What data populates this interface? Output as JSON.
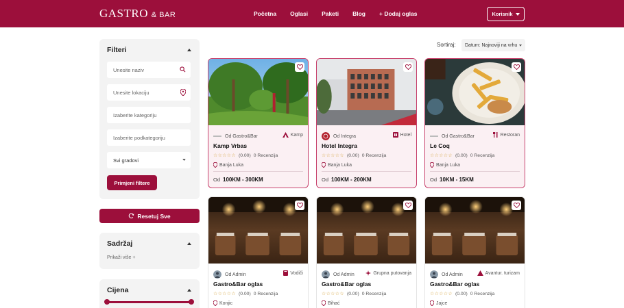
{
  "header": {
    "logo_main": "GASTRO",
    "logo_amp": "& BAR",
    "nav": [
      "Početna",
      "Oglasi",
      "Paketi",
      "Blog",
      "+ Dodaj oglas"
    ],
    "user_label": "Korisnik"
  },
  "filters": {
    "title": "Filteri",
    "name_placeholder": "Unesite naziv",
    "location_placeholder": "Unesite lokaciju",
    "category_placeholder": "Izaberite kategoriju",
    "subcategory_placeholder": "Izaberite podkategoriju",
    "city_select": "Svi gradovi",
    "apply_label": "Primjeni filtere"
  },
  "reset_label": "Resetuj Sve",
  "content_panel": {
    "title": "Sadržaj",
    "show_more": "Prikaži više +"
  },
  "price_panel": {
    "title": "Cijena"
  },
  "sort": {
    "label": "Sortiraj:",
    "value": "Datum: Najnoviji na vrhu"
  },
  "colors": {
    "brand": "#9c0f3b",
    "panel_bg": "#f3f3f3",
    "highlight_border": "#c7416c"
  },
  "cards": [
    {
      "owner": "Od Gastro&Bar",
      "category": "Kamp",
      "category_icon": "tent-icon",
      "title": "Kamp Vrbas",
      "stars": "☆☆☆☆☆",
      "rating": "(0.00)",
      "reviews": "0 Recenzija",
      "location": "Banja Luka",
      "price_prefix": "Od",
      "price": "100KM - 300KM",
      "image": "park-photo"
    },
    {
      "owner": "Od Integra",
      "category": "Hotel",
      "category_icon": "hotel-icon",
      "title": "Hotel Integra",
      "stars": "☆☆☆☆☆",
      "rating": "(0.00)",
      "reviews": "0 Recenzija",
      "location": "Banja Luka",
      "price_prefix": "Od",
      "price": "100KM - 200KM",
      "image": "building-photo"
    },
    {
      "owner": "Od Gastro&Bar",
      "category": "Restoran",
      "category_icon": "fork-knife-icon",
      "title": "Le Coq",
      "stars": "☆☆☆☆☆",
      "rating": "(0.00)",
      "reviews": "0 Recenzija",
      "location": "Banja Luka",
      "price_prefix": "Od",
      "price": "10KM - 15KM",
      "image": "food-photo"
    },
    {
      "owner": "Od Admin",
      "category": "Vodiči",
      "category_icon": "book-icon",
      "title": "Gastro&Bar oglas",
      "stars": "☆☆☆☆☆",
      "rating": "(0.00)",
      "reviews": "0 Recenzija",
      "location": "Konjic",
      "image": "restaurant-photo"
    },
    {
      "owner": "Od Admin",
      "category": "Grupna putovanja",
      "category_icon": "plane-icon",
      "title": "Gastro&Bar oglas",
      "stars": "☆☆☆☆☆",
      "rating": "(0.00)",
      "reviews": "0 Recenzija",
      "location": "Bihać",
      "image": "restaurant-photo"
    },
    {
      "owner": "Od Admin",
      "category": "Avantur. turizam",
      "category_icon": "mountain-icon",
      "title": "Gastro&Bar oglas",
      "stars": "☆☆☆☆☆",
      "rating": "(0.00)",
      "reviews": "0 Recenzija",
      "location": "Jajce",
      "image": "restaurant-photo"
    }
  ]
}
